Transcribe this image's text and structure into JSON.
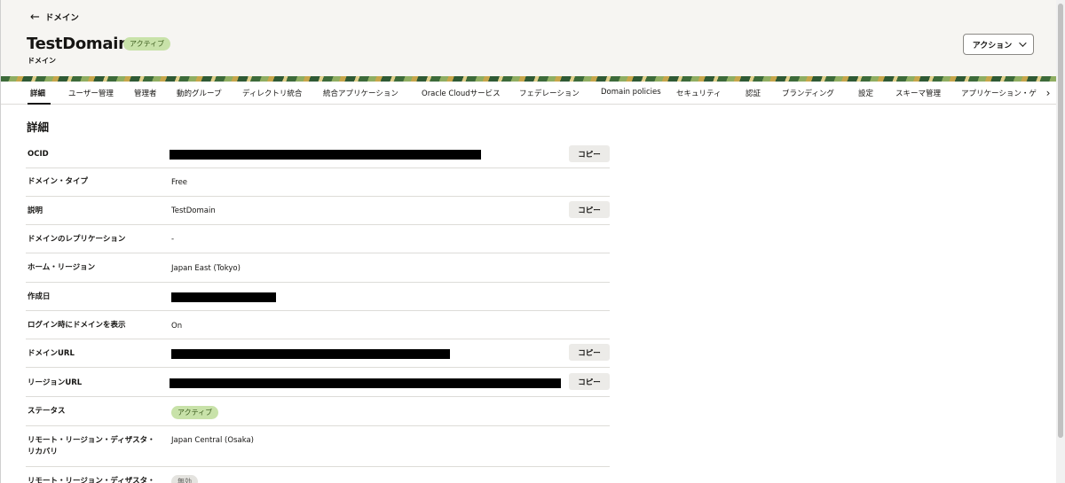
{
  "header": {
    "back_label": "ドメイン",
    "title": "TestDomain",
    "status_badge": "アクティブ",
    "subtitle": "ドメイン",
    "actions_label": "アクション"
  },
  "tabs": [
    {
      "label": "詳細",
      "active": true
    },
    {
      "label": "ユーザー管理"
    },
    {
      "label": "管理者"
    },
    {
      "label": "動的グループ"
    },
    {
      "label": "ディレクトリ統合"
    },
    {
      "label": "統合アプリケーション"
    },
    {
      "label": "Oracle Cloudサービス"
    },
    {
      "label": "フェデレーション"
    },
    {
      "label": "Domain policies"
    },
    {
      "label": "セキュリティ"
    },
    {
      "label": "認証"
    },
    {
      "label": "ブランディング"
    },
    {
      "label": "設定"
    },
    {
      "label": "スキーマ管理"
    },
    {
      "label": "アプリケーション・ゲ"
    }
  ],
  "details": {
    "section_title": "詳細",
    "copy_label": "コピー",
    "rows": [
      {
        "label": "OCID",
        "redacted": true,
        "copy": true
      },
      {
        "label": "ドメイン・タイプ",
        "value": "Free"
      },
      {
        "label": "説明",
        "value": "TestDomain",
        "copy": true
      },
      {
        "label": "ドメインのレプリケーション",
        "value": "-"
      },
      {
        "label": "ホーム・リージョン",
        "value": "Japan East (Tokyo)"
      },
      {
        "label": "作成日",
        "redacted": true
      },
      {
        "label": "ログイン時にドメインを表示",
        "value": "On"
      },
      {
        "label": "ドメインURL",
        "redacted": true,
        "copy": true
      },
      {
        "label": "リージョンURL",
        "redacted": true,
        "copy": true
      },
      {
        "label": "ステータス",
        "badge": "アクティブ"
      },
      {
        "label_line1": "リモート・リージョン・ディザスタ・",
        "label_line2": "リカバリ",
        "value": "Japan Central (Osaka)"
      },
      {
        "label": "リモート・リージョン・ディザスタ・",
        "badge": "無効"
      }
    ]
  },
  "colors": {
    "header_bg": "#f6f5f2",
    "badge_bg": "#c8e2a9",
    "copy_bg": "#ecebe8"
  }
}
